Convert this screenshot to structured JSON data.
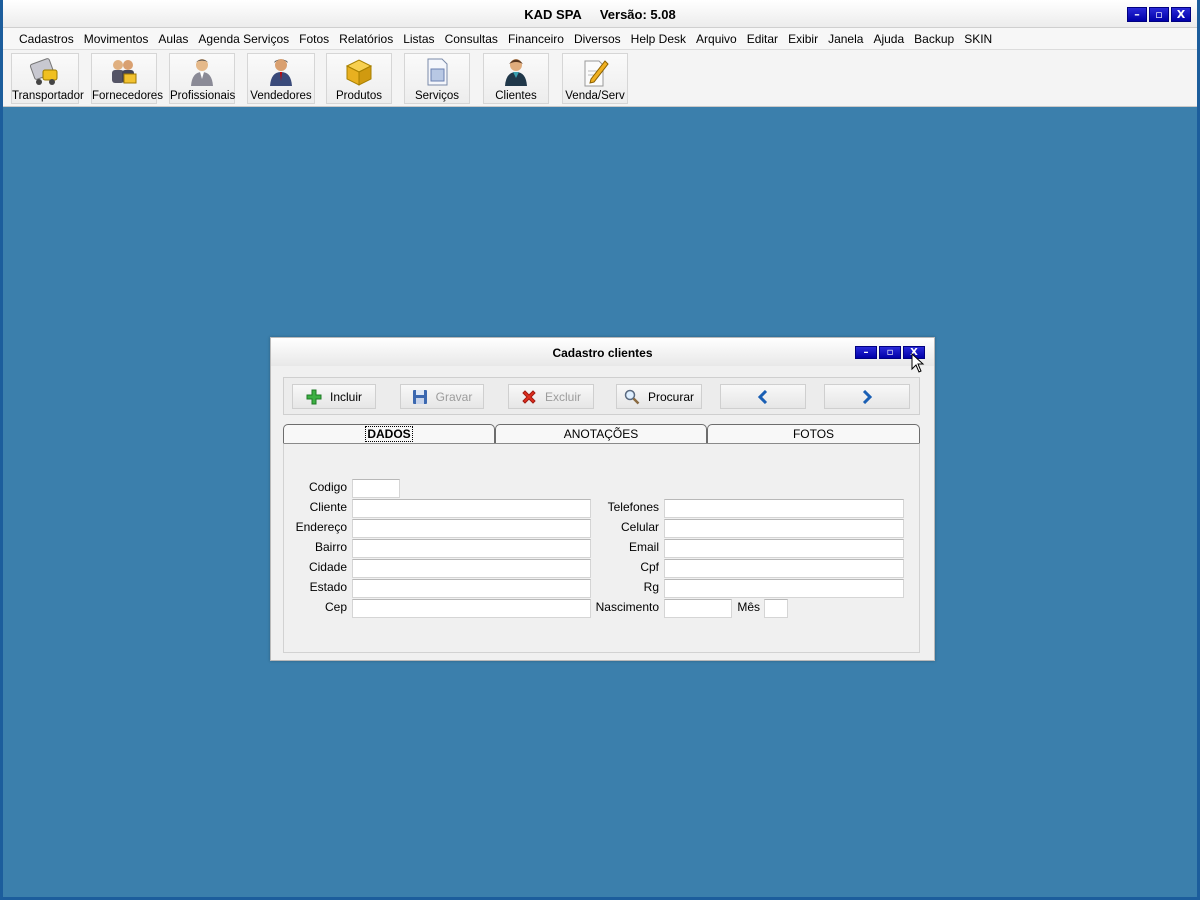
{
  "app": {
    "title_name": "KAD SPA",
    "title_version": "Versão: 5.08",
    "window_buttons": [
      "–",
      "▫",
      "X"
    ]
  },
  "menubar": {
    "items": [
      "Cadastros",
      "Movimentos",
      "Aulas",
      "Agenda Serviços",
      "Fotos",
      "Relatórios",
      "Listas",
      "Consultas",
      "Financeiro",
      "Diversos",
      "Help Desk",
      "Arquivo",
      "Editar",
      "Exibir",
      "Janela",
      "Ajuda",
      "Backup",
      "SKIN"
    ]
  },
  "toolbar": {
    "buttons": [
      {
        "label": "Transportador",
        "icon": "truck-icon"
      },
      {
        "label": "Fornecedores",
        "icon": "suppliers-icon"
      },
      {
        "label": "Profissionais",
        "icon": "professional-icon"
      },
      {
        "label": "Vendedores",
        "icon": "seller-icon"
      },
      {
        "label": "Produtos",
        "icon": "box-icon"
      },
      {
        "label": "Serviços",
        "icon": "document-icon"
      },
      {
        "label": "Clientes",
        "icon": "client-icon"
      },
      {
        "label": "Venda/Serv",
        "icon": "pencil-paper-icon"
      }
    ]
  },
  "dialog": {
    "title": "Cadastro clientes",
    "toolbar": {
      "incluir": "Incluir",
      "gravar": "Gravar",
      "excluir": "Excluir",
      "procurar": "Procurar"
    },
    "tabs": [
      "DADOS",
      "ANOTAÇÕES",
      "FOTOS"
    ],
    "active_tab": "DADOS",
    "fields_left": {
      "codigo": {
        "label": "Codigo",
        "value": ""
      },
      "cliente": {
        "label": "Cliente",
        "value": ""
      },
      "endereco": {
        "label": "Endereço",
        "value": ""
      },
      "bairro": {
        "label": "Bairro",
        "value": ""
      },
      "cidade": {
        "label": "Cidade",
        "value": ""
      },
      "estado": {
        "label": "Estado",
        "value": ""
      },
      "cep": {
        "label": "Cep",
        "value": ""
      }
    },
    "fields_right": {
      "telefones": {
        "label": "Telefones",
        "value": ""
      },
      "celular": {
        "label": "Celular",
        "value": ""
      },
      "email": {
        "label": "Email",
        "value": ""
      },
      "cpf": {
        "label": "Cpf",
        "value": ""
      },
      "rg": {
        "label": "Rg",
        "value": ""
      },
      "nascimento": {
        "label": "Nascimento",
        "value": ""
      },
      "mes": {
        "label": "Mês",
        "value": ""
      }
    }
  },
  "colors": {
    "desktop": "#3b7fac",
    "window_button": "#0000a8",
    "nav_arrow": "#1a5fb4"
  }
}
